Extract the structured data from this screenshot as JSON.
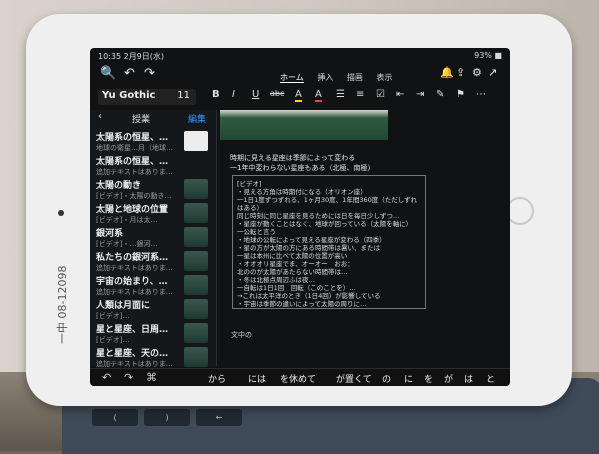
{
  "status": {
    "time_date": "10:35 2月9日(水)",
    "right": "93% ■"
  },
  "toolbar": {
    "tabs": [
      "ホーム",
      "挿入",
      "描画",
      "表示"
    ],
    "font_name": "Yu Gothic",
    "font_size": "11",
    "format_labels": [
      "B",
      "I",
      "U",
      "abc",
      "A",
      "A"
    ]
  },
  "sidebar": {
    "back_glyph": "‹",
    "title": "授業",
    "edit_label": "編集",
    "notes": [
      {
        "title": "太陽系の恒星、…",
        "snippet": "地球の衛星…月（地球…"
      },
      {
        "title": "太陽系の恒星、…",
        "snippet": "追加テキストはありま…"
      },
      {
        "title": "太陽の動き",
        "snippet": "[ビデオ]・太陽の動き…"
      },
      {
        "title": "太陽と地球の位置",
        "snippet": "[ビデオ]・月は太…"
      },
      {
        "title": "銀河系",
        "snippet": "[ビデオ]・…銀河…"
      },
      {
        "title": "私たちの銀河系…",
        "snippet": "追加テキストはありま…"
      },
      {
        "title": "宇宙の始まり、…",
        "snippet": "追加テキストはありま…"
      },
      {
        "title": "人類は月面に",
        "snippet": "[ビデオ]…"
      },
      {
        "title": "星と星座、日周…",
        "snippet": "[ビデオ]…"
      },
      {
        "title": "星と星座、天の…",
        "snippet": "追加テキストはありま…"
      }
    ]
  },
  "content": {
    "lines": [
      "時期に見える星座は季節によって変わる",
      "一1年中変わらない星座もある（北極、南極）"
    ],
    "video_lines": [
      "[ビデオ]",
      "・見える方角は時期付になる（オリオン座）",
      "一1日1度ずつずれる、1ヶ月30度、1年間360度（ただしずれはある）",
      "同じ時刻に同じ星座を見るためには日を毎日少しずつ…",
      "・星座が動くことはなく、地球が回っている（太陽を軸に）",
      "一公転と言う",
      "・地球の公転によって見える星座が変わる（四季）",
      "・星の方が太陽の方にある時間帯は暑い、または",
      "一星は本州に比べて太陽の位置が高い",
      "・オオオリ星座でま、オーオー　おお：",
      "北ののが太陽があたらない時間帯は…",
      "・冬は北極点周辺ふは夜…",
      "一自転は1日1回　回転（このことを）…",
      "→これは太平洋のとき（1日4回）が影響している",
      "・宇宙は季節の違いによって太陽の周りに…"
    ],
    "cursor_text": "文中の"
  },
  "candidates": {
    "icons": [
      "↶",
      "↷",
      "⌘"
    ],
    "words": [
      "から",
      "には",
      "を休めて",
      "が置くて",
      "の",
      "に",
      "を",
      "が",
      "は",
      "と"
    ]
  },
  "sticker": {
    "text": "一中 08-12098"
  },
  "keyboard": {
    "keys": [
      "+",
      "×",
      "⌘",
      "@",
      "#",
      "$",
      "%",
      "&",
      "*",
      "(",
      ")",
      "←"
    ]
  }
}
